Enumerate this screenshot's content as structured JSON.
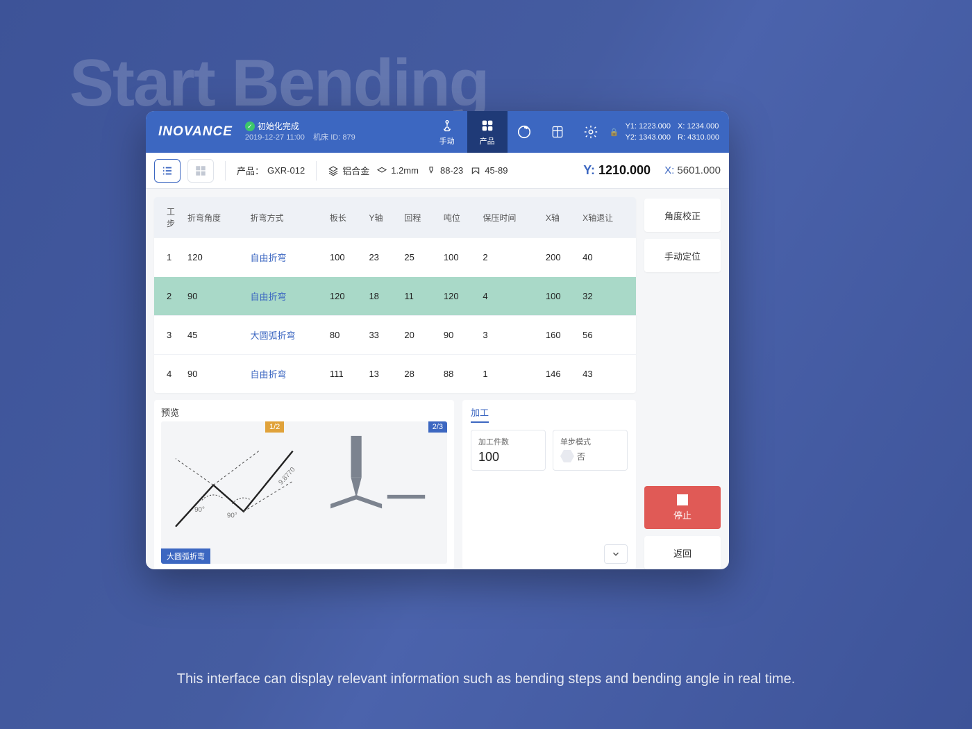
{
  "background": {
    "title": "Start Bending"
  },
  "caption": "This interface can display relevant information such as bending steps and bending angle in real time.",
  "header": {
    "logo": "INOVANCE",
    "status": {
      "text": "初始化完成",
      "datetime": "2019-12-27 11:00",
      "machine_id_label": "机床 ID:",
      "machine_id": "879"
    },
    "nav": {
      "manual": "手动",
      "product": "产品"
    },
    "coords": {
      "y1_label": "Y1:",
      "y1": "1223.000",
      "x_label": "X:",
      "x": "1234.000",
      "y2_label": "Y2:",
      "y2": "1343.000",
      "r_label": "R:",
      "r": "4310.000"
    }
  },
  "infobar": {
    "product_label": "产品：",
    "product_value": "GXR-012",
    "material": "铝合金",
    "thickness": "1.2mm",
    "tool1": "88-23",
    "tool2": "45-89",
    "y_label": "Y:",
    "y_value": "1210.000",
    "x_label": "X:",
    "x_value": "5601.000"
  },
  "table": {
    "headers": [
      "工步",
      "折弯角度",
      "折弯方式",
      "板长",
      "Y轴",
      "回程",
      "吨位",
      "保压时间",
      "X轴",
      "X轴退让"
    ],
    "rows": [
      {
        "sel": false,
        "c": [
          "1",
          "120",
          "自由折弯",
          "100",
          "23",
          "25",
          "100",
          "2",
          "200",
          "40"
        ]
      },
      {
        "sel": true,
        "c": [
          "2",
          "90",
          "自由折弯",
          "120",
          "18",
          "11",
          "120",
          "4",
          "100",
          "32"
        ]
      },
      {
        "sel": false,
        "c": [
          "3",
          "45",
          "大圆弧折弯",
          "80",
          "33",
          "20",
          "90",
          "3",
          "160",
          "56"
        ]
      },
      {
        "sel": false,
        "c": [
          "4",
          "90",
          "自由折弯",
          "111",
          "13",
          "28",
          "88",
          "1",
          "146",
          "43"
        ]
      }
    ]
  },
  "preview": {
    "title": "预览",
    "badge1": "1/2",
    "badge2": "2/3",
    "tag": "大圆弧折弯",
    "arc_label": "9.8770",
    "angle1": "90°",
    "angle2": "90°"
  },
  "process": {
    "title": "加工",
    "count_label": "加工件数",
    "count_value": "100",
    "step_mode_label": "单步模式",
    "step_mode_value": "否"
  },
  "sidebar": {
    "angle_correct": "角度校正",
    "manual_position": "手动定位",
    "stop": "停止",
    "back": "返回"
  }
}
